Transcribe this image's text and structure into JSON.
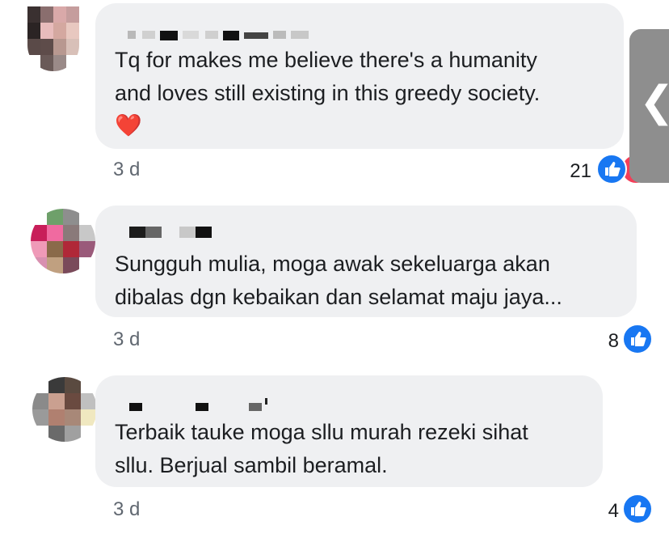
{
  "comments": [
    {
      "text_lines": [
        "Tq for makes me believe there's a humanity",
        "and loves still existing in this greedy society."
      ],
      "emoji": "❤️",
      "time": "3 d",
      "reaction_count": "21",
      "reaction_icons": [
        "like-icon",
        "love-icon"
      ]
    },
    {
      "text_lines": [
        "Sungguh mulia, moga awak sekeluarga akan",
        "dibalas dgn kebaikan dan selamat maju jaya..."
      ],
      "time": "3 d",
      "reaction_count": "8",
      "reaction_icons": [
        "like-icon"
      ]
    },
    {
      "text_lines": [
        "Terbaik tauke moga sllu murah rezeki sihat",
        "sllu. Berjual sambil beramal."
      ],
      "time": "3 d",
      "reaction_count": "4",
      "reaction_icons": [
        "like-icon"
      ]
    }
  ],
  "side_tab": {
    "glyph": "❮"
  },
  "colors": {
    "bubble": "#eff0f2",
    "like_blue": "#1877f2",
    "love_red": "#f33e58",
    "time_gray": "#606770"
  }
}
